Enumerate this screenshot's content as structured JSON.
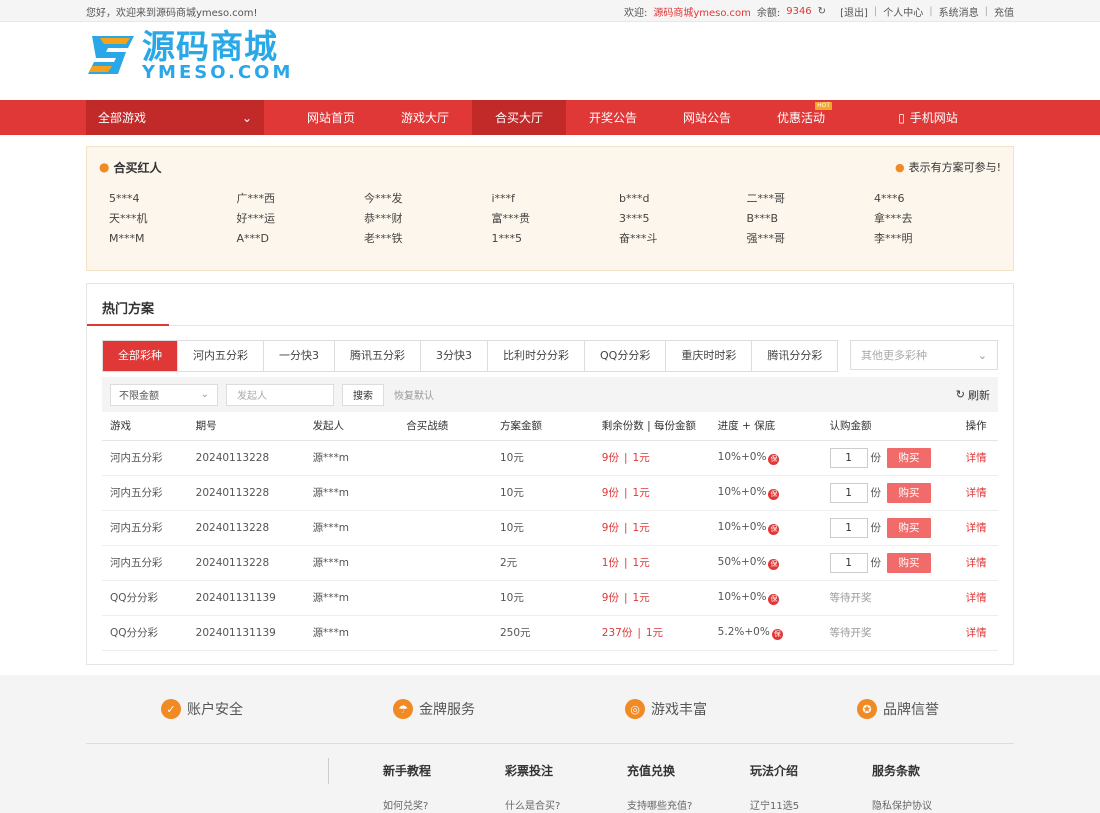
{
  "topbar": {
    "greeting": "您好，欢迎来到源码商城ymeso.com!",
    "welcome_label": "欢迎:",
    "site_user": "源码商城ymeso.com",
    "balance_label": "余额:",
    "balance_value": "9346",
    "logout": "[退出]",
    "personal_center": "个人中心",
    "system_message": "系统消息",
    "recharge": "充值"
  },
  "logo": {
    "cn": "源码商城",
    "en": "YMESO.COM"
  },
  "nav": {
    "all_games": "全部游戏",
    "items": [
      "网站首页",
      "游戏大厅",
      "合买大厅",
      "开奖公告",
      "网站公告",
      "优惠活动"
    ],
    "hot_badge": "HOT",
    "mobile": "手机网站"
  },
  "hongren": {
    "title": "合买红人",
    "note": "表示有方案可参与!",
    "names": [
      "5***4",
      "广***西",
      "今***发",
      "i***f",
      "b***d",
      "二***哥",
      "4***6",
      "天***机",
      "好***运",
      "恭***财",
      "富***贵",
      "3***5",
      "B***B",
      "拿***去",
      "M***M",
      "A***D",
      "老***铁",
      "1***5",
      "奋***斗",
      "强***哥",
      "李***明"
    ]
  },
  "hot_plans": {
    "title": "热门方案",
    "tabs": [
      "全部彩种",
      "河内五分彩",
      "一分快3",
      "腾讯五分彩",
      "3分快3",
      "比利时分分彩",
      "QQ分分彩",
      "重庆时时彩",
      "腾讯分分彩"
    ],
    "more_placeholder": "其他更多彩种",
    "filter_amount": "不限金额",
    "initiator_placeholder": "发起人",
    "search": "搜索",
    "reset": "恢复默认",
    "refresh": "刷新",
    "columns": [
      "游戏",
      "期号",
      "发起人",
      "合买战绩",
      "方案金额",
      "剩余份数 | 每份金额",
      "进度 + 保底",
      "认购金额",
      "操作"
    ],
    "rows": [
      {
        "game": "河内五分彩",
        "period": "20240113228",
        "initiator": "源***m",
        "amount": "10元",
        "remaining": "9份",
        "per": "1元",
        "progress": "10%+0%",
        "qty": "1",
        "unit": "份",
        "action": "购买",
        "detail": "详情"
      },
      {
        "game": "河内五分彩",
        "period": "20240113228",
        "initiator": "源***m",
        "amount": "10元",
        "remaining": "9份",
        "per": "1元",
        "progress": "10%+0%",
        "qty": "1",
        "unit": "份",
        "action": "购买",
        "detail": "详情"
      },
      {
        "game": "河内五分彩",
        "period": "20240113228",
        "initiator": "源***m",
        "amount": "10元",
        "remaining": "9份",
        "per": "1元",
        "progress": "10%+0%",
        "qty": "1",
        "unit": "份",
        "action": "购买",
        "detail": "详情"
      },
      {
        "game": "河内五分彩",
        "period": "20240113228",
        "initiator": "源***m",
        "amount": "2元",
        "remaining": "1份",
        "per": "1元",
        "progress": "50%+0%",
        "qty": "1",
        "unit": "份",
        "action": "购买",
        "detail": "详情"
      },
      {
        "game": "QQ分分彩",
        "period": "202401131139",
        "initiator": "源***m",
        "amount": "10元",
        "remaining": "9份",
        "per": "1元",
        "progress": "10%+0%",
        "status": "等待开奖",
        "detail": "详情"
      },
      {
        "game": "QQ分分彩",
        "period": "202401131139",
        "initiator": "源***m",
        "amount": "250元",
        "remaining": "237份",
        "per": "1元",
        "progress": "5.2%+0%",
        "status": "等待开奖",
        "detail": "详情"
      }
    ],
    "bao": "保"
  },
  "footer": {
    "features": [
      "账户安全",
      "金牌服务",
      "游戏丰富",
      "品牌信誉"
    ],
    "link_cols": [
      {
        "title": "新手教程",
        "link": "如何兑奖?"
      },
      {
        "title": "彩票投注",
        "link": "什么是合买?"
      },
      {
        "title": "充值兑换",
        "link": "支持哪些充值?"
      },
      {
        "title": "玩法介绍",
        "link": "辽宁11选5"
      },
      {
        "title": "服务条款",
        "link": "隐私保护协议"
      }
    ]
  },
  "colors": {
    "brand_red": "#e03737",
    "logo_blue": "#29a7e6",
    "logo_orange": "#f7a21b"
  }
}
